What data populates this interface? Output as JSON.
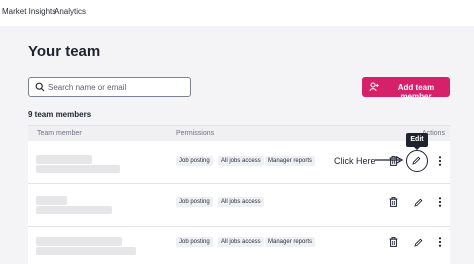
{
  "topnav": {
    "items": [
      "Market Insights",
      "Analytics"
    ]
  },
  "page": {
    "title": "Your team"
  },
  "search": {
    "placeholder": "Search name or email"
  },
  "add_member": {
    "label": "Add team member"
  },
  "team": {
    "count_label": "9 team members"
  },
  "table": {
    "headers": {
      "member": "Team member",
      "permissions": "Permissions",
      "actions": "Actions"
    },
    "rows": [
      {
        "permissions": [
          "Job posting",
          "All jobs access",
          "Manager reports"
        ]
      },
      {
        "permissions": [
          "Job posting",
          "All jobs access"
        ]
      },
      {
        "permissions": [
          "Job posting",
          "All jobs access",
          "Manager reports"
        ]
      }
    ]
  },
  "annotation": {
    "click_label": "Click Here",
    "tooltip": "Edit"
  },
  "colors": {
    "accent": "#d6216a",
    "text": "#1f2330",
    "background": "#f4f4f6"
  },
  "icons": [
    "search-icon",
    "add-user-icon",
    "trash-icon",
    "pencil-icon",
    "more-vertical-icon",
    "arrow-right-icon"
  ]
}
